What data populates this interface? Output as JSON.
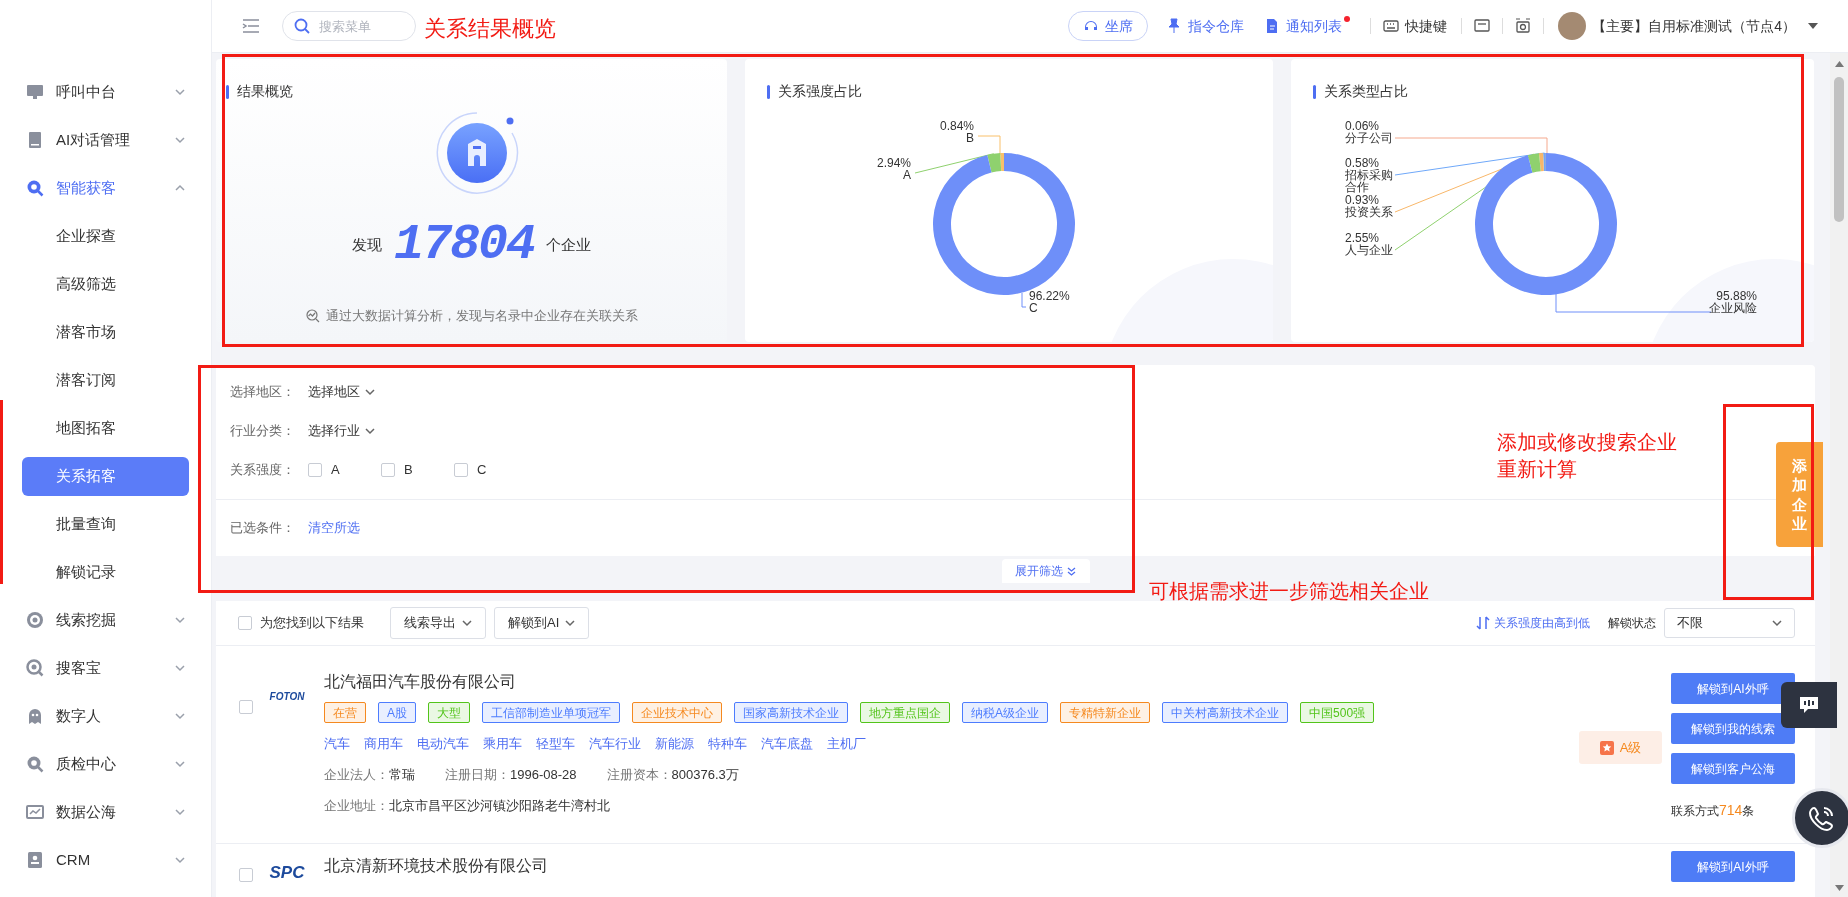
{
  "topbar": {
    "search": {
      "placeholder": "搜索菜单"
    },
    "actions": [
      {
        "label": "坐席",
        "kind": "pill",
        "badge": false
      },
      {
        "label": "指令仓库",
        "kind": "link",
        "badge": false
      },
      {
        "label": "通知列表",
        "kind": "link",
        "badge": true
      },
      {
        "label": "快捷键",
        "kind": "plain",
        "badge": false
      }
    ],
    "user": "【主要】自用标准测试（节点4）"
  },
  "sidebar": {
    "items": [
      {
        "label": "呼叫中台",
        "expanded": false,
        "selected": false
      },
      {
        "label": "AI对话管理",
        "expanded": false,
        "selected": false
      },
      {
        "label": "智能获客",
        "expanded": true,
        "selected": true,
        "children": [
          {
            "label": "企业探查",
            "selected": false
          },
          {
            "label": "高级筛选",
            "selected": false
          },
          {
            "label": "潜客市场",
            "selected": false
          },
          {
            "label": "潜客订阅",
            "selected": false
          },
          {
            "label": "地图拓客",
            "selected": false
          },
          {
            "label": "关系拓客",
            "selected": true
          },
          {
            "label": "批量查询",
            "selected": false
          },
          {
            "label": "解锁记录",
            "selected": false
          }
        ]
      },
      {
        "label": "线索挖掘",
        "expanded": false,
        "selected": false
      },
      {
        "label": "搜客宝",
        "expanded": false,
        "selected": false
      },
      {
        "label": "数字人",
        "expanded": false,
        "selected": false
      },
      {
        "label": "质检中心",
        "expanded": false,
        "selected": false
      },
      {
        "label": "数据公海",
        "expanded": false,
        "selected": false
      },
      {
        "label": "CRM",
        "expanded": false,
        "selected": false
      }
    ]
  },
  "overview": {
    "title": "结果概览",
    "prefix": "发现",
    "count": "17804",
    "suffix": "个企业",
    "caption": "通过大数据计算分析，发现与名录中企业存在关联关系"
  },
  "charts": [
    {
      "title": "关系强度占比",
      "chart_data": {
        "type": "donut",
        "categories": [
          "B",
          "A",
          "C"
        ],
        "values": [
          0.84,
          2.94,
          96.22
        ],
        "value_labels": [
          "0.84%",
          "2.94%",
          "96.22%"
        ]
      }
    },
    {
      "title": "关系类型占比",
      "chart_data": {
        "type": "donut",
        "categories": [
          "分子公司",
          "招标采购合作",
          "投资关系",
          "人与企业",
          "企业风险"
        ],
        "values": [
          0.06,
          0.58,
          0.93,
          2.55,
          95.88
        ],
        "value_labels": [
          "0.06%",
          "0.58%",
          "0.93%",
          "2.55%",
          "95.88%"
        ]
      }
    }
  ],
  "filters": {
    "rows": [
      {
        "label": "选择地区：",
        "kind": "dropdown",
        "value": "选择地区"
      },
      {
        "label": "行业分类：",
        "kind": "dropdown",
        "value": "选择行业"
      },
      {
        "label": "关系强度：",
        "kind": "checkboxes",
        "options": [
          {
            "label": "A",
            "checked": false
          },
          {
            "label": "B",
            "checked": false
          },
          {
            "label": "C",
            "checked": false
          }
        ]
      }
    ],
    "selected_label": "已选条件：",
    "clear": "清空所选",
    "expand": "展开筛选"
  },
  "add_button": "添加企业",
  "results": {
    "select_all": {
      "label": "为您找到以下结果",
      "checked": false
    },
    "buttons": [
      "线索导出",
      "解锁到AI"
    ],
    "sort": "关系强度由高到低",
    "status_label": "解锁状态",
    "status_value": "不限",
    "companies": [
      {
        "name": "北汽福田汽车股份有限公司",
        "logo_text": "FOTON",
        "checked": false,
        "tags": [
          {
            "text": "在营",
            "color": "#f5891f"
          },
          {
            "text": "A股",
            "color": "#4d7cfe"
          },
          {
            "text": "大型",
            "color": "#52c41a"
          },
          {
            "text": "工信部制造业单项冠军",
            "color": "#4d7cfe"
          },
          {
            "text": "企业技术中心",
            "color": "#f5891f"
          },
          {
            "text": "国家高新技术企业",
            "color": "#4d7cfe"
          },
          {
            "text": "地方重点国企",
            "color": "#52c41a"
          },
          {
            "text": "纳税A级企业",
            "color": "#4d7cfe"
          },
          {
            "text": "专精特新企业",
            "color": "#f5891f"
          },
          {
            "text": "中关村高新技术企业",
            "color": "#4d7cfe"
          },
          {
            "text": "中国500强",
            "color": "#52c41a"
          }
        ],
        "keywords": [
          "汽车",
          "商用车",
          "电动汽车",
          "乘用车",
          "轻型车",
          "汽车行业",
          "新能源",
          "特种车",
          "汽车底盘",
          "主机厂"
        ],
        "info": [
          {
            "label": "企业法人：",
            "value": "常瑞"
          },
          {
            "label": "注册日期：",
            "value": "1996-08-28"
          },
          {
            "label": "注册资本：",
            "value": "800376.3万"
          }
        ],
        "address": {
          "label": "企业地址：",
          "value": "北京市昌平区沙河镇沙阳路老牛湾村北"
        },
        "grade": "A级",
        "actions": [
          "解锁到AI外呼",
          "解锁到我的线索",
          "解锁到客户公海"
        ],
        "contacts": {
          "prefix": "联系方式",
          "count": "714",
          "suffix": "条"
        }
      },
      {
        "name": "北京清新环境技术股份有限公司",
        "logo_text": "SPC",
        "checked": false,
        "actions": [
          "解锁到AI外呼"
        ]
      }
    ]
  },
  "annotations": [
    {
      "kind": "text",
      "text": "关系结果概览"
    },
    {
      "kind": "box"
    },
    {
      "kind": "box"
    },
    {
      "kind": "text",
      "text": "添加或修改搜索企业"
    },
    {
      "kind": "text",
      "text": "重新计算"
    },
    {
      "kind": "box"
    },
    {
      "kind": "text",
      "text": "可根据需求进一步筛选相关企业"
    },
    {
      "kind": "line"
    }
  ]
}
